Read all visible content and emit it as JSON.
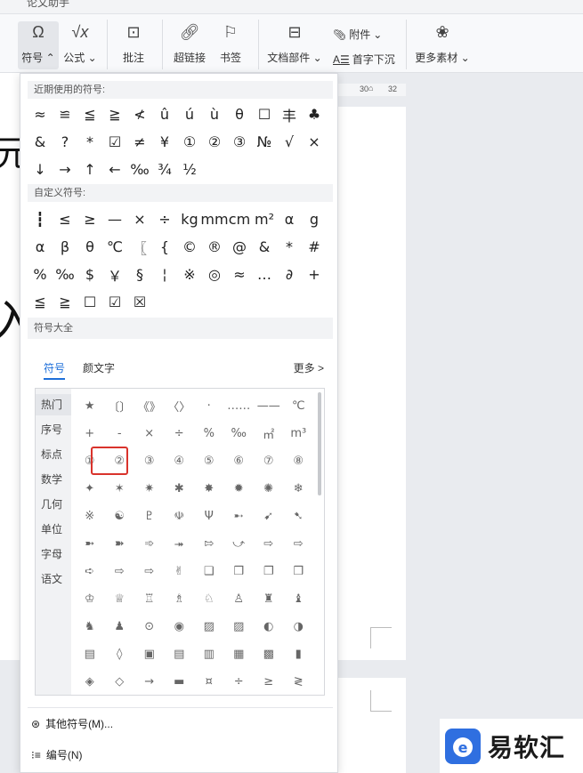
{
  "top_strip": {
    "tab_text": "论文助手"
  },
  "ribbon": {
    "symbol": "符号",
    "formula": "公式",
    "comment": "批注",
    "hyperlink": "超链接",
    "bookmark": "书签",
    "doc_parts": "文档部件",
    "attachment": "附件",
    "drop_cap": "首字下沉",
    "more_assets": "更多素材"
  },
  "ruler": {
    "t30": "30",
    "t32": "32"
  },
  "doc_text": {
    "char1": "元",
    "char2": "入"
  },
  "panel": {
    "recent_title": "近期使用的符号:",
    "recent": [
      "≈",
      "≌",
      "≦",
      "≧",
      "≮",
      "û",
      "ú",
      "ù",
      "θ",
      "☐",
      "丰",
      "♣",
      "&",
      "?",
      "*",
      "☑",
      "≠",
      "¥",
      "①",
      "②",
      "③",
      "№",
      "√",
      "×",
      "↓",
      "→",
      "↑",
      "←",
      "‰",
      "¾",
      "½"
    ],
    "custom_title": "自定义符号:",
    "custom": [
      "┇",
      "≤",
      "≥",
      "—",
      "×",
      "÷",
      "kg",
      "mm",
      "cm",
      "m²",
      "α",
      "g",
      "α",
      "β",
      "θ",
      "℃",
      "〖",
      "{",
      "©",
      "®",
      "@",
      "&",
      "*",
      "#",
      "%",
      "‰",
      "$",
      "￥",
      "§",
      "¦",
      "※",
      "◎",
      "≈",
      "…",
      "∂",
      "+",
      "≦",
      "≧",
      "☐",
      "☑",
      "☒"
    ],
    "library_title": "符号大全",
    "tabs": {
      "symbols": "符号",
      "kaomoji": "颜文字",
      "more": "更多 >"
    },
    "categories": [
      "热门",
      "序号",
      "标点",
      "数学",
      "几何",
      "单位",
      "字母",
      "语文"
    ],
    "library": [
      "★",
      "〔〕",
      "《》",
      "〈〉",
      "·",
      "……",
      "——",
      "℃",
      "+",
      "-",
      "×",
      "÷",
      "%",
      "‰",
      "㎡",
      "m³",
      "①",
      "②",
      "③",
      "④",
      "⑤",
      "⑥",
      "⑦",
      "⑧",
      "✦",
      "✶",
      "✷",
      "✱",
      "✸",
      "✹",
      "✺",
      "❄",
      "※",
      "☯",
      "♇",
      "☫",
      "Ψ",
      "➸",
      "➹",
      "➷",
      "➼",
      "➽",
      "➾",
      "⯮",
      "⇰",
      "⤻",
      "⇨",
      "⇨",
      "➪",
      "⇨",
      "⇨",
      "✌",
      "❑",
      "❒",
      "❐",
      "❒",
      "♔",
      "♕",
      "♖",
      "♗",
      "♘",
      "♙",
      "♜",
      "♝",
      "♞",
      "♟",
      "⊙",
      "◉",
      "▨",
      "▨",
      "◐",
      "◑",
      "▤",
      "◊",
      "▣",
      "▤",
      "▥",
      "▦",
      "▩",
      "▮",
      "◈",
      "◇",
      "→",
      "▬",
      "¤",
      "÷",
      "≥",
      "≷"
    ],
    "other_symbols": "其他符号(M)...",
    "numbering": "编号(N)"
  },
  "watermark": {
    "text": "易软汇"
  }
}
